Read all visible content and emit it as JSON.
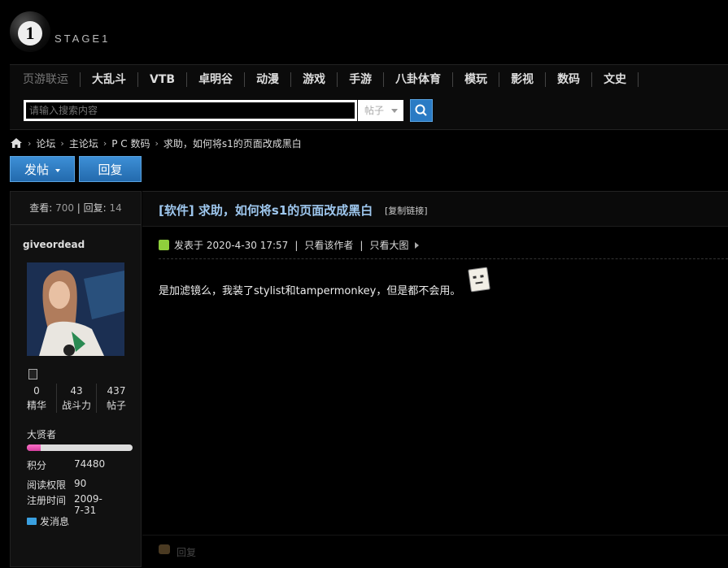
{
  "logo": {
    "glyph": "1",
    "word": "STAGE1"
  },
  "nav": {
    "items": [
      "页游联运",
      "大乱斗",
      "VTB",
      "卓明谷",
      "动漫",
      "游戏",
      "手游",
      "八卦体育",
      "模玩",
      "影视",
      "数码",
      "文史"
    ]
  },
  "search": {
    "placeholder": "请输入搜索内容",
    "type": "帖子"
  },
  "breadcrumb": {
    "items": [
      "论坛",
      "主论坛",
      "P C 数码",
      "求助，如何将s1的页面改成黑白"
    ]
  },
  "actions": {
    "post": "发帖",
    "reply": "回复"
  },
  "thread_stats": {
    "views_label": "查看:",
    "views": "700",
    "replies_label": "回复:",
    "replies": "14"
  },
  "user": {
    "name": "giveordead",
    "counts": [
      {
        "value": "0",
        "label": "精华"
      },
      {
        "value": "43",
        "label": "战斗力"
      },
      {
        "value": "437",
        "label": "帖子"
      }
    ],
    "rank": "大贤者",
    "rank_progress": 0.13,
    "info": [
      {
        "label": "积分",
        "value": "74480"
      },
      {
        "label": "阅读权限",
        "value": "90"
      },
      {
        "label": "注册时间",
        "value": "2009-7-31"
      }
    ],
    "message": "发消息"
  },
  "post": {
    "title": "[软件] 求助，如何将s1的页面改成黑白",
    "copy_link": "[复制链接]",
    "posted": "发表于 2020-4-30 17:57",
    "author_only": "只看该作者",
    "big_image": "只看大图",
    "body": "是加滤镜么，我装了stylist和tampermonkey，但是都不会用。",
    "reply": "回复"
  },
  "colors": {
    "accent": "#2a7bc4",
    "title": "#9ec7ee",
    "rank_bar": "#d43f9e"
  }
}
